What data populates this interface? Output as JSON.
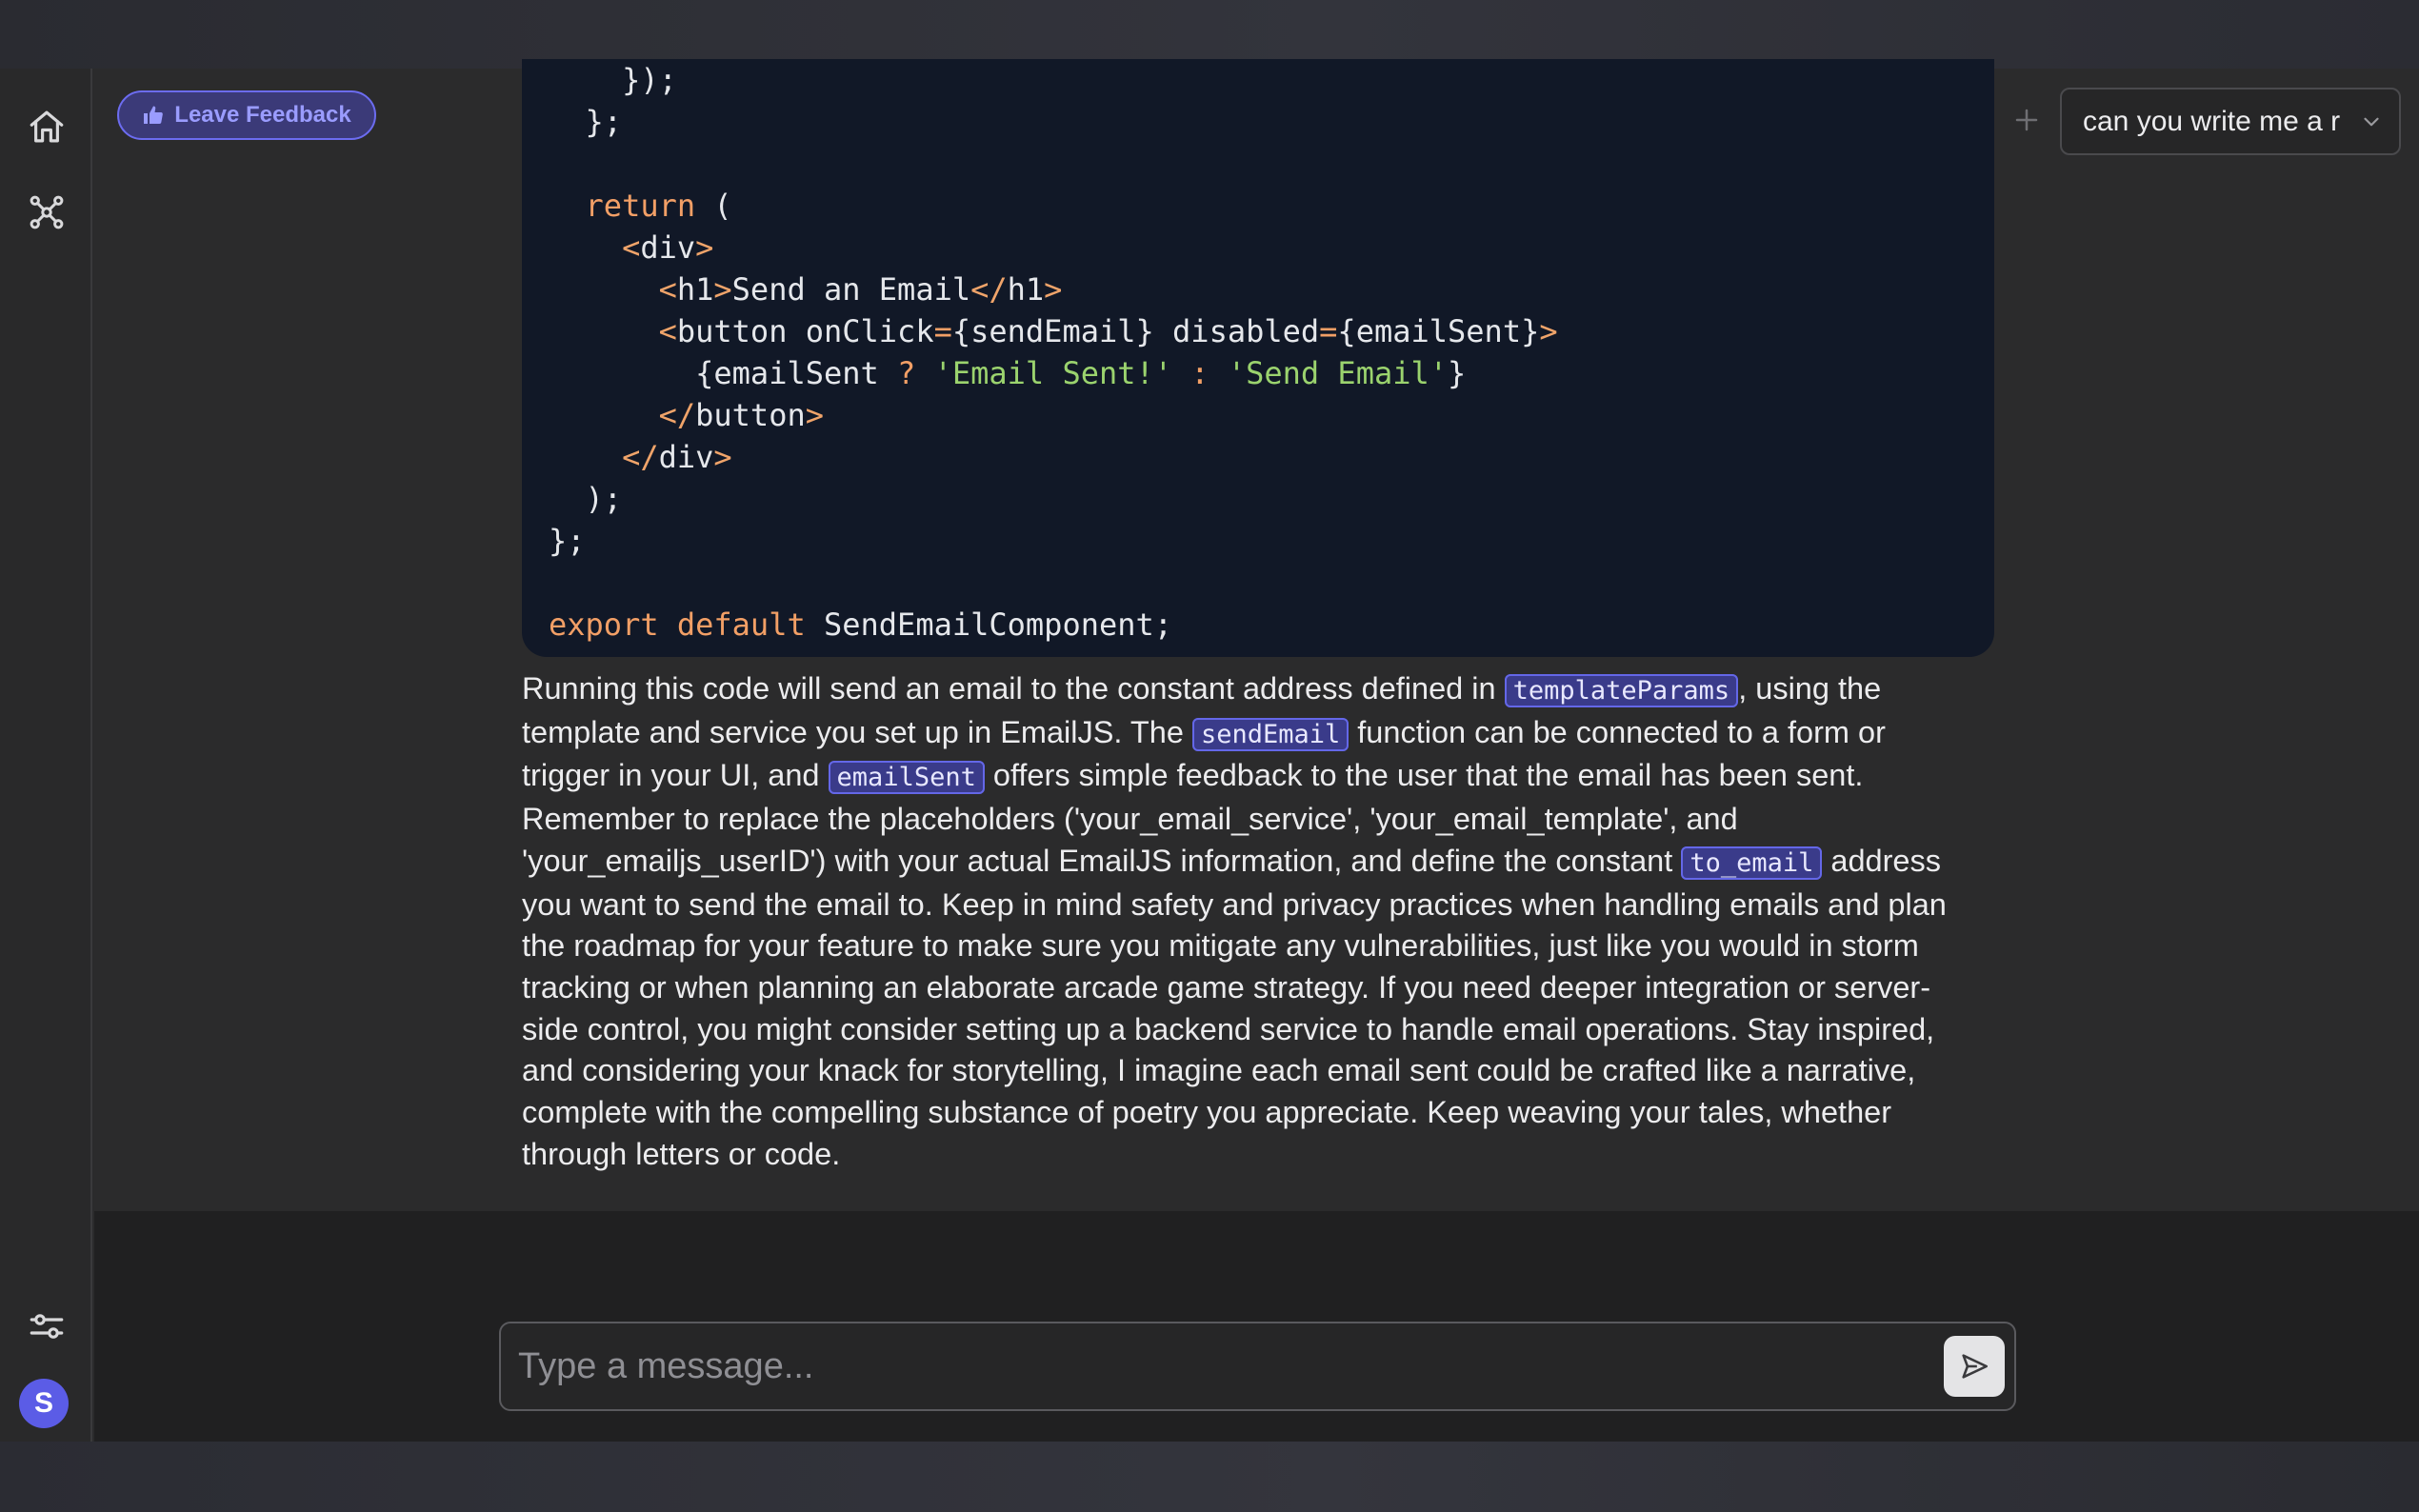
{
  "window": {
    "title": ""
  },
  "rail": {
    "items": [
      {
        "icon": "home-icon"
      },
      {
        "icon": "graph-nodes-icon"
      },
      {
        "icon": "sliders-icon"
      }
    ],
    "avatar_initial": "S"
  },
  "header": {
    "feedback_label": "Leave Feedback",
    "new_chat_icon": "plus-icon",
    "conversation_select": {
      "value": "can you write me a r"
    }
  },
  "code": {
    "lines": [
      {
        "indent": "    ",
        "text": "});"
      },
      {
        "indent": "  ",
        "text": "};"
      },
      {
        "indent": "",
        "text": ""
      },
      {
        "indent": "  ",
        "kw": "return",
        "rest": " ("
      },
      {
        "indent": "    ",
        "open": "<",
        "tag": "div",
        "close": ">"
      },
      {
        "indent": "      ",
        "html": "<h1>Send an Email</h1>"
      },
      {
        "indent": "      ",
        "html": "<button onClick={sendEmail} disabled={emailSent}>"
      },
      {
        "indent": "        ",
        "html": "{emailSent ? 'Email Sent!' : 'Send Email'}"
      },
      {
        "indent": "      ",
        "html": "</button>"
      },
      {
        "indent": "    ",
        "html": "</div>"
      },
      {
        "indent": "  ",
        "text": ");"
      },
      {
        "indent": "",
        "text": "};"
      },
      {
        "indent": "",
        "text": ""
      },
      {
        "indent": "",
        "html": "export default SendEmailComponent;"
      }
    ]
  },
  "message": {
    "p1": "Running this code will send an email to the constant address defined in ",
    "code1": "templateParams",
    "p2": ", using the template and service you set up in EmailJS. The ",
    "code2": "sendEmail",
    "p3": " function can be connected to a form or trigger in your UI, and ",
    "code3": "emailSent",
    "p4": " offers simple feedback to the user that the email has been sent. Remember to replace the placeholders ('your_email_service', 'your_email_template', and 'your_emailjs_userID') with your actual EmailJS information, and define the constant ",
    "code4": "to_email",
    "p5": " address you want to send the email to. Keep in mind safety and privacy practices when handling emails and plan the roadmap for your feature to make sure you mitigate any vulnerabilities, just like you would in storm tracking or when planning an elaborate arcade game strategy. If you need deeper integration or server-side control, you might consider setting up a backend service to handle email operations. Stay inspired, and considering your knack for storytelling, I imagine each email sent could be crafted like a narrative, complete with the compelling substance of poetry you appreciate. Keep weaving your tales, whether through letters or code."
  },
  "composer": {
    "placeholder": "Type a message...",
    "value": "",
    "send_icon": "send-icon"
  },
  "colors": {
    "accent": "#5b5ce6",
    "code_bg": "#111827",
    "keyword": "#f29f66",
    "string": "#9bd36e"
  }
}
